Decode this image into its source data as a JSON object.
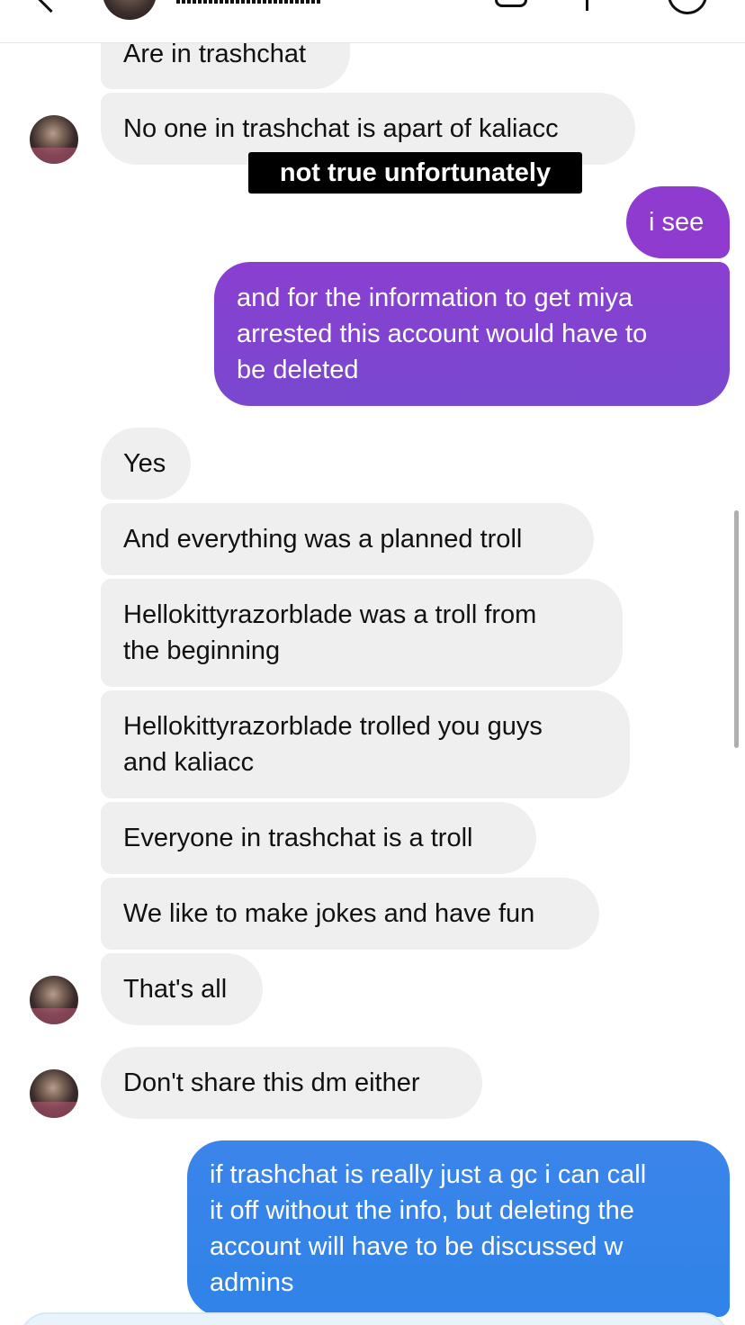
{
  "header": {
    "back_icon": "chevron-left-icon",
    "avatar": "profile-photo",
    "actions": [
      "video-call-icon",
      "phone-call-icon",
      "info-icon"
    ]
  },
  "messages": [
    {
      "text": "Are in trashchat",
      "sender": "them"
    },
    {
      "text": "No one in trashchat is apart of kaliacc",
      "sender": "them"
    },
    {
      "text": "i see",
      "sender": "me"
    },
    {
      "text": "and for the information to get miya\narrested this account would have to\nbe deleted",
      "sender": "me"
    },
    {
      "text": "Yes",
      "sender": "them"
    },
    {
      "text": "And everything was a planned troll",
      "sender": "them"
    },
    {
      "text": "Hellokittyrazorblade was a troll from\nthe beginning",
      "sender": "them"
    },
    {
      "text": "Hellokittyrazorblade trolled you guys\nand kaliacc",
      "sender": "them"
    },
    {
      "text": "Everyone in trashchat is a troll",
      "sender": "them"
    },
    {
      "text": "We like to make jokes and have fun",
      "sender": "them"
    },
    {
      "text": "That's all",
      "sender": "them"
    },
    {
      "text": "Don't share this dm either",
      "sender": "them"
    },
    {
      "text": "if trashchat is really just a gc i can call\nit off without the info, but deleting the\naccount will have to be discussed w\nadmins",
      "sender": "me"
    }
  ],
  "caption": "not true unfortunately",
  "colors": {
    "incoming_bubble": "#efefef",
    "outgoing_purple_top": "#8a3cd0",
    "outgoing_purple_bottom": "#7b46cf",
    "outgoing_blue": "#3388ea",
    "caption_bg": "#000000"
  }
}
